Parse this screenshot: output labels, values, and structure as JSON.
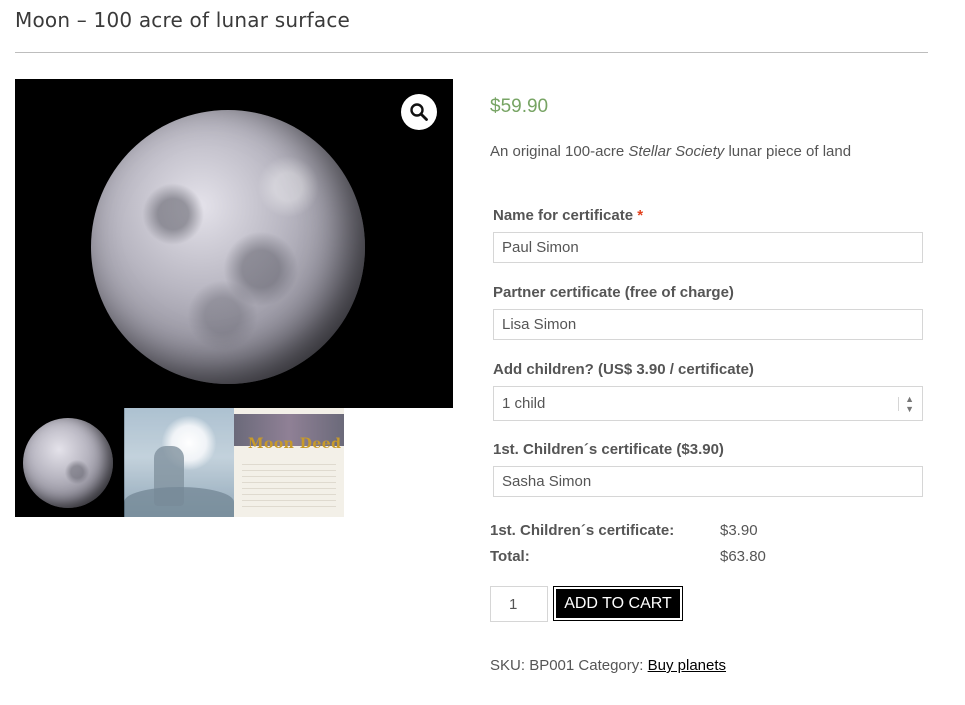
{
  "product": {
    "title": "Moon – 100 acre of lunar surface",
    "price": "$59.90",
    "description": {
      "before": "An original 100-acre ",
      "emphasis": "Stellar Society",
      "after": " lunar piece of land"
    }
  },
  "gallery": {
    "zoom_icon": "search-icon",
    "thumbnails": [
      "moon",
      "person-under-full-moon",
      "moon-deed-certificate"
    ],
    "deed_label": "Moon Deed"
  },
  "form": {
    "name_label": "Name for certificate",
    "required_mark": "*",
    "name_value": "Paul Simon",
    "partner_label": "Partner certificate (free of charge)",
    "partner_value": "Lisa Simon",
    "children_label": "Add children? (US$ 3.90 / certificate)",
    "children_selected": "1 child",
    "child1_label": "1st. Children´s certificate ($3.90)",
    "child1_value": "Sasha Simon"
  },
  "totals": {
    "line_label": "1st. Children´s certificate:",
    "line_value": "$3.90",
    "total_label": "Total:",
    "total_value": "$63.80"
  },
  "cart": {
    "quantity": "1",
    "button_label": "ADD TO CART"
  },
  "meta": {
    "sku_label": "SKU:",
    "sku_value": "BP001",
    "category_label": "Category:",
    "category_link": "Buy planets"
  },
  "colors": {
    "price": "#77a464",
    "required": "#e2401c",
    "button_bg": "#000000"
  }
}
